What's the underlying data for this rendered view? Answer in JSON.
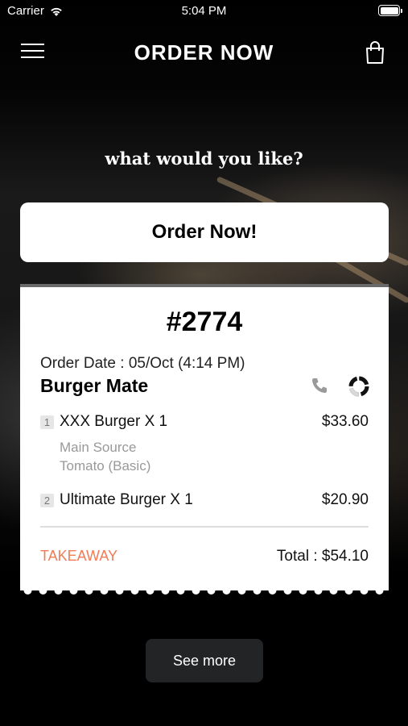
{
  "status_bar": {
    "carrier": "Carrier",
    "time": "5:04 PM"
  },
  "nav": {
    "title": "ORDER NOW"
  },
  "prompt": "what would you like?",
  "order_button_label": "Order Now!",
  "ticket": {
    "order_number": "#2774",
    "order_date": "Order Date : 05/Oct (4:14 PM)",
    "store_name": "Burger Mate",
    "items": [
      {
        "index": "1",
        "name": "XXX Burger X 1",
        "price": "$33.60",
        "options": [
          "Main Source",
          "Tomato (Basic)"
        ]
      },
      {
        "index": "2",
        "name": "Ultimate Burger X 1",
        "price": "$20.90",
        "options": []
      }
    ],
    "order_type": "TAKEAWAY",
    "total": "Total : $54.10"
  },
  "see_more_label": "See more",
  "colors": {
    "accent": "#f27c56",
    "ticket_bg": "#ffffff",
    "see_more_bg": "#222426"
  }
}
